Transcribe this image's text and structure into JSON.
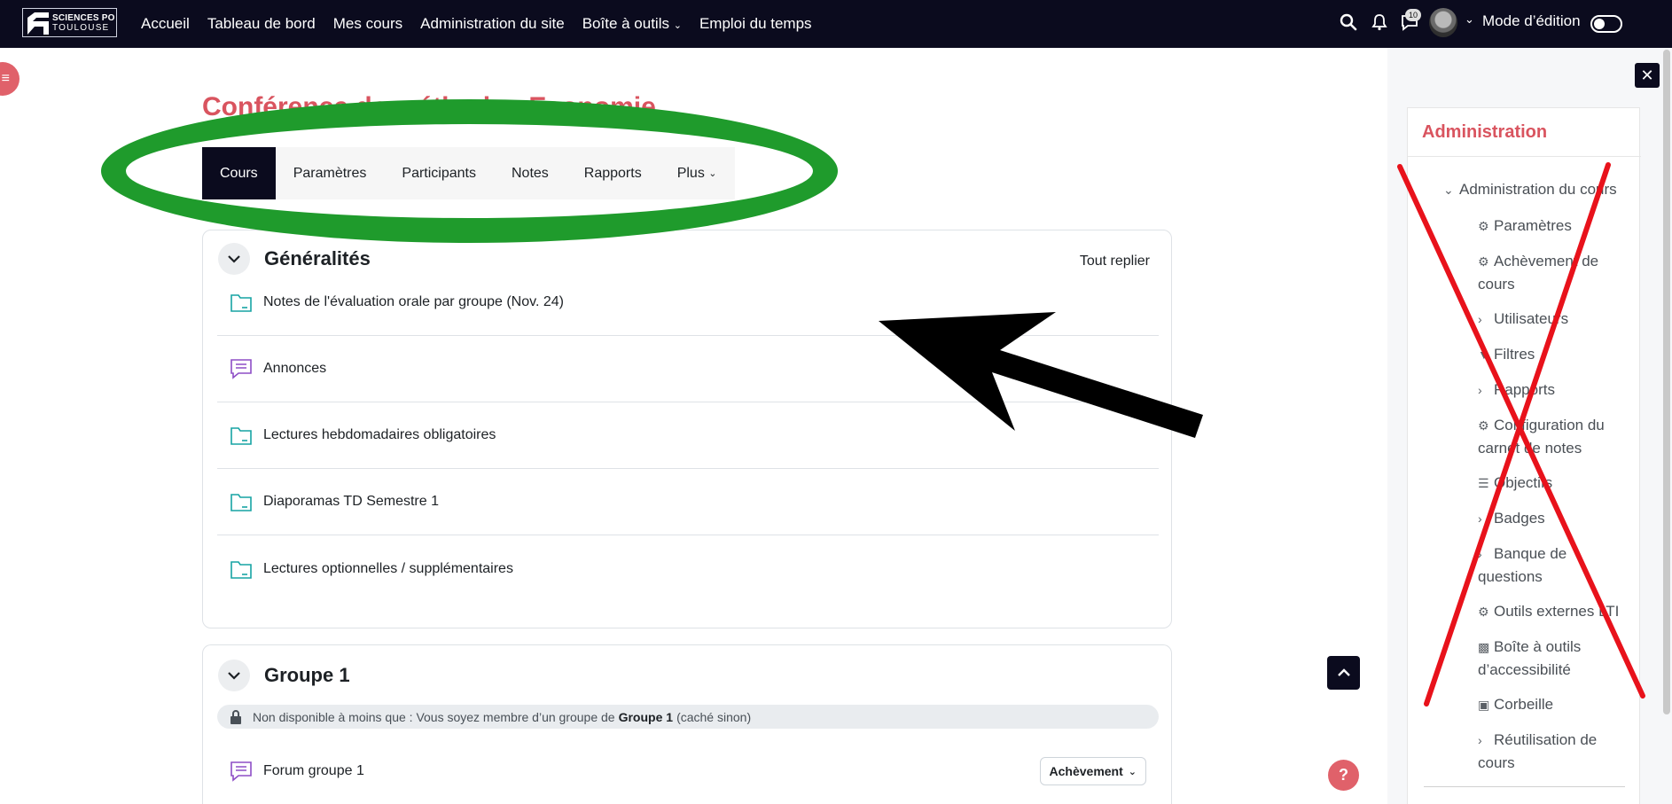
{
  "navbar": {
    "logo_line1": "SCIENCES PO",
    "logo_line2": "TOULOUSE",
    "links": [
      "Accueil",
      "Tableau de bord",
      "Mes cours",
      "Administration du site",
      "Boîte à outils",
      "Emploi du temps"
    ],
    "notification_badge": "10",
    "edit_mode_label": "Mode d’édition"
  },
  "course": {
    "title": "Conférence de méthode - Economie"
  },
  "secondary_nav": {
    "tabs": [
      "Cours",
      "Paramètres",
      "Participants",
      "Notes",
      "Rapports",
      "Plus"
    ]
  },
  "section_general": {
    "title": "Généralités",
    "collapse_all": "Tout replier",
    "activities": [
      {
        "name": "Notes de l'évaluation orale par groupe (Nov. 24)",
        "icon": "folder-icon"
      },
      {
        "name": "Annonces",
        "icon": "forum-icon"
      },
      {
        "name": "Lectures hebdomadaires obligatoires",
        "icon": "folder-icon"
      },
      {
        "name": "Diaporamas TD Semestre 1",
        "icon": "folder-icon"
      },
      {
        "name": "Lectures optionnelles / supplémentaires",
        "icon": "folder-icon"
      }
    ]
  },
  "section_group1": {
    "title": "Groupe 1",
    "restriction_before": "Non disponible à moins que : Vous soyez membre d’un groupe de",
    "restriction_group": "Groupe 1",
    "restriction_after": "(caché sinon)",
    "activity_name": "Forum groupe 1",
    "completion_label": "Achèvement"
  },
  "drawer": {
    "title": "Administration",
    "items": [
      {
        "label": "Administration du cours",
        "icon": "chevron-down-icon"
      },
      {
        "label": "Paramètres",
        "icon": "gear-icon"
      },
      {
        "label": "Achèvement de",
        "label2": "cours",
        "icon": "gear-icon"
      },
      {
        "label": "Utilisateurs",
        "icon": "chevron-right-icon"
      },
      {
        "label": "Filtres",
        "icon": "filter-icon"
      },
      {
        "label": "Rapports",
        "icon": "chevron-right-icon"
      },
      {
        "label": "Configuration du",
        "label2": "carnet de notes",
        "icon": "gear-icon"
      },
      {
        "label": "Objectifs",
        "icon": "checklist-icon"
      },
      {
        "label": "Badges",
        "icon": "chevron-right-icon"
      },
      {
        "label": "Banque de",
        "label2": "questions",
        "icon": "chevron-right-icon"
      },
      {
        "label": "Outils externes LTI",
        "icon": "gear-icon"
      },
      {
        "label": "Boîte à outils",
        "label2": "d’accessibilité",
        "icon": "chart-icon"
      },
      {
        "label": "Corbeille",
        "icon": "trash-icon"
      },
      {
        "label": "Réutilisation de",
        "label2": "cours",
        "icon": "chevron-right-icon"
      }
    ]
  },
  "colors": {
    "navbar": "#0b0b1e",
    "accent": "#d9545f",
    "annotation_green": "#1f9b2c",
    "annotation_red": "#e8121b"
  }
}
